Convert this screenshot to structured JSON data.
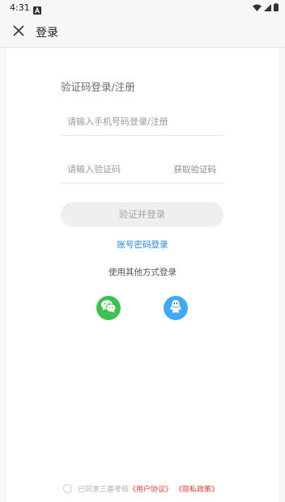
{
  "status_bar": {
    "time": "4:31",
    "icons": [
      "notification-a-icon",
      "wifi-icon",
      "signal-icon",
      "battery-icon"
    ]
  },
  "app_bar": {
    "title": "登录",
    "close_icon": "close-icon"
  },
  "login": {
    "section_title": "验证码登录/注册",
    "phone_placeholder": "请输入手机号码登录/注册",
    "phone_value": "",
    "code_placeholder": "请输入验证码",
    "code_value": "",
    "get_code_label": "获取验证码",
    "submit_label": "验证并登录",
    "password_login_link": "账号密码登录"
  },
  "other_login": {
    "title": "使用其他方式登录",
    "providers": [
      {
        "name": "wechat",
        "icon": "wechat-icon",
        "color": "#3fc152"
      },
      {
        "name": "qq",
        "icon": "qq-icon",
        "color": "#3fa9f5"
      }
    ]
  },
  "agreement": {
    "checked": false,
    "prefix": "已同意三基考核",
    "user_agreement": "《用户协议》",
    "privacy_policy": "《隐私政策》"
  },
  "colors": {
    "link_blue": "#1e88e5",
    "agreement_red": "#e53935",
    "wechat_green": "#3fc152",
    "qq_blue": "#3fa9f5"
  }
}
